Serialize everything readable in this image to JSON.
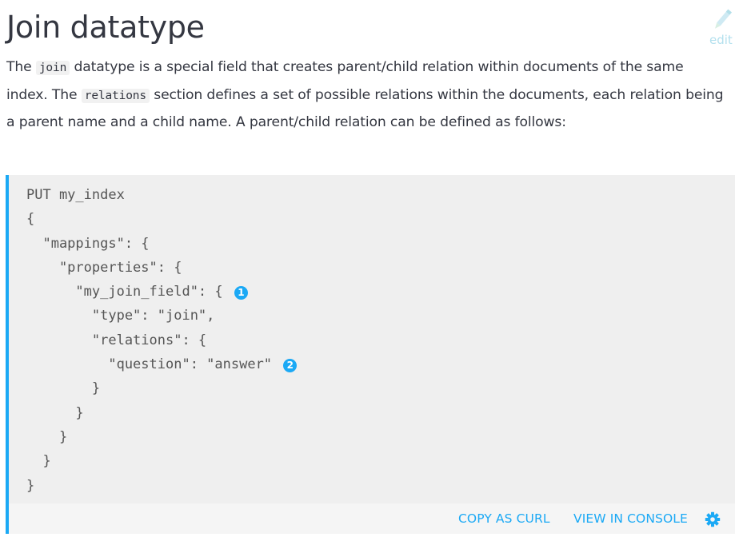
{
  "page": {
    "title": "Join datatype",
    "edit_label": "edit"
  },
  "intro": {
    "t1": "The ",
    "code1": "join",
    "t2": " datatype is a special field that creates parent/child relation within documents of the same index. The ",
    "code2": "relations",
    "t3": " section defines a set of possible relations within the documents, each relation being a parent name and a child name. A parent/child relation can be defined as follows:"
  },
  "code": {
    "lines": [
      "PUT my_index",
      "{",
      "  \"mappings\": {",
      "    \"properties\": {",
      "      \"my_join_field\": { ",
      "        \"type\": \"join\",",
      "        \"relations\": {",
      "          \"question\": \"answer\" ",
      "        }",
      "      }",
      "    }",
      "  }",
      "}"
    ],
    "callouts": [
      "1",
      "2"
    ]
  },
  "actions": {
    "copy_curl": "COPY AS CURL",
    "view_console": "VIEW IN CONSOLE"
  },
  "icons": {
    "edit": "pencil-icon",
    "settings": "gear-icon"
  },
  "colors": {
    "accent": "#1ba9f5",
    "text": "#343741",
    "code_text": "#555555",
    "code_bg": "#efefef",
    "edit": "#b3e0ee"
  }
}
